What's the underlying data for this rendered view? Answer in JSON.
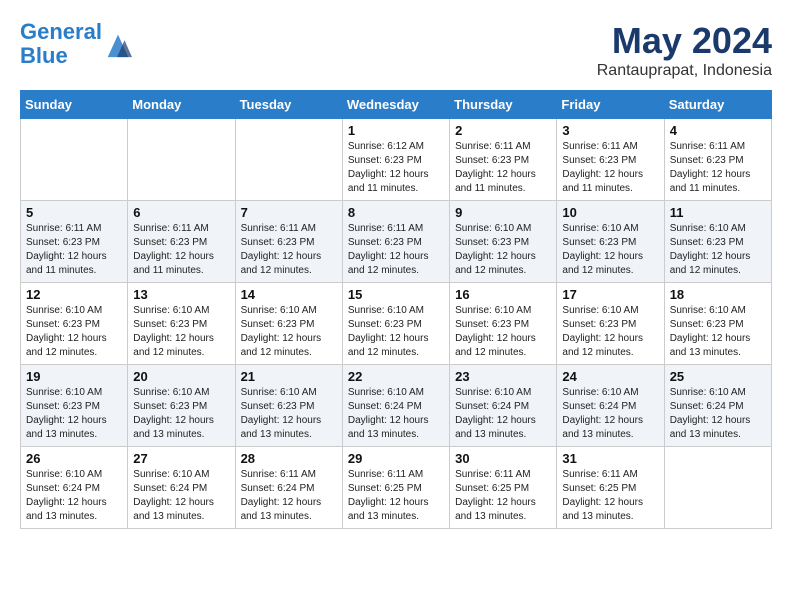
{
  "header": {
    "logo_line1": "General",
    "logo_line2": "Blue",
    "month": "May 2024",
    "location": "Rantauprapat, Indonesia"
  },
  "weekdays": [
    "Sunday",
    "Monday",
    "Tuesday",
    "Wednesday",
    "Thursday",
    "Friday",
    "Saturday"
  ],
  "weeks": [
    [
      {
        "day": "",
        "info": ""
      },
      {
        "day": "",
        "info": ""
      },
      {
        "day": "",
        "info": ""
      },
      {
        "day": "1",
        "info": "Sunrise: 6:12 AM\nSunset: 6:23 PM\nDaylight: 12 hours\nand 11 minutes."
      },
      {
        "day": "2",
        "info": "Sunrise: 6:11 AM\nSunset: 6:23 PM\nDaylight: 12 hours\nand 11 minutes."
      },
      {
        "day": "3",
        "info": "Sunrise: 6:11 AM\nSunset: 6:23 PM\nDaylight: 12 hours\nand 11 minutes."
      },
      {
        "day": "4",
        "info": "Sunrise: 6:11 AM\nSunset: 6:23 PM\nDaylight: 12 hours\nand 11 minutes."
      }
    ],
    [
      {
        "day": "5",
        "info": "Sunrise: 6:11 AM\nSunset: 6:23 PM\nDaylight: 12 hours\nand 11 minutes."
      },
      {
        "day": "6",
        "info": "Sunrise: 6:11 AM\nSunset: 6:23 PM\nDaylight: 12 hours\nand 11 minutes."
      },
      {
        "day": "7",
        "info": "Sunrise: 6:11 AM\nSunset: 6:23 PM\nDaylight: 12 hours\nand 12 minutes."
      },
      {
        "day": "8",
        "info": "Sunrise: 6:11 AM\nSunset: 6:23 PM\nDaylight: 12 hours\nand 12 minutes."
      },
      {
        "day": "9",
        "info": "Sunrise: 6:10 AM\nSunset: 6:23 PM\nDaylight: 12 hours\nand 12 minutes."
      },
      {
        "day": "10",
        "info": "Sunrise: 6:10 AM\nSunset: 6:23 PM\nDaylight: 12 hours\nand 12 minutes."
      },
      {
        "day": "11",
        "info": "Sunrise: 6:10 AM\nSunset: 6:23 PM\nDaylight: 12 hours\nand 12 minutes."
      }
    ],
    [
      {
        "day": "12",
        "info": "Sunrise: 6:10 AM\nSunset: 6:23 PM\nDaylight: 12 hours\nand 12 minutes."
      },
      {
        "day": "13",
        "info": "Sunrise: 6:10 AM\nSunset: 6:23 PM\nDaylight: 12 hours\nand 12 minutes."
      },
      {
        "day": "14",
        "info": "Sunrise: 6:10 AM\nSunset: 6:23 PM\nDaylight: 12 hours\nand 12 minutes."
      },
      {
        "day": "15",
        "info": "Sunrise: 6:10 AM\nSunset: 6:23 PM\nDaylight: 12 hours\nand 12 minutes."
      },
      {
        "day": "16",
        "info": "Sunrise: 6:10 AM\nSunset: 6:23 PM\nDaylight: 12 hours\nand 12 minutes."
      },
      {
        "day": "17",
        "info": "Sunrise: 6:10 AM\nSunset: 6:23 PM\nDaylight: 12 hours\nand 12 minutes."
      },
      {
        "day": "18",
        "info": "Sunrise: 6:10 AM\nSunset: 6:23 PM\nDaylight: 12 hours\nand 13 minutes."
      }
    ],
    [
      {
        "day": "19",
        "info": "Sunrise: 6:10 AM\nSunset: 6:23 PM\nDaylight: 12 hours\nand 13 minutes."
      },
      {
        "day": "20",
        "info": "Sunrise: 6:10 AM\nSunset: 6:23 PM\nDaylight: 12 hours\nand 13 minutes."
      },
      {
        "day": "21",
        "info": "Sunrise: 6:10 AM\nSunset: 6:23 PM\nDaylight: 12 hours\nand 13 minutes."
      },
      {
        "day": "22",
        "info": "Sunrise: 6:10 AM\nSunset: 6:24 PM\nDaylight: 12 hours\nand 13 minutes."
      },
      {
        "day": "23",
        "info": "Sunrise: 6:10 AM\nSunset: 6:24 PM\nDaylight: 12 hours\nand 13 minutes."
      },
      {
        "day": "24",
        "info": "Sunrise: 6:10 AM\nSunset: 6:24 PM\nDaylight: 12 hours\nand 13 minutes."
      },
      {
        "day": "25",
        "info": "Sunrise: 6:10 AM\nSunset: 6:24 PM\nDaylight: 12 hours\nand 13 minutes."
      }
    ],
    [
      {
        "day": "26",
        "info": "Sunrise: 6:10 AM\nSunset: 6:24 PM\nDaylight: 12 hours\nand 13 minutes."
      },
      {
        "day": "27",
        "info": "Sunrise: 6:10 AM\nSunset: 6:24 PM\nDaylight: 12 hours\nand 13 minutes."
      },
      {
        "day": "28",
        "info": "Sunrise: 6:11 AM\nSunset: 6:24 PM\nDaylight: 12 hours\nand 13 minutes."
      },
      {
        "day": "29",
        "info": "Sunrise: 6:11 AM\nSunset: 6:25 PM\nDaylight: 12 hours\nand 13 minutes."
      },
      {
        "day": "30",
        "info": "Sunrise: 6:11 AM\nSunset: 6:25 PM\nDaylight: 12 hours\nand 13 minutes."
      },
      {
        "day": "31",
        "info": "Sunrise: 6:11 AM\nSunset: 6:25 PM\nDaylight: 12 hours\nand 13 minutes."
      },
      {
        "day": "",
        "info": ""
      }
    ]
  ]
}
